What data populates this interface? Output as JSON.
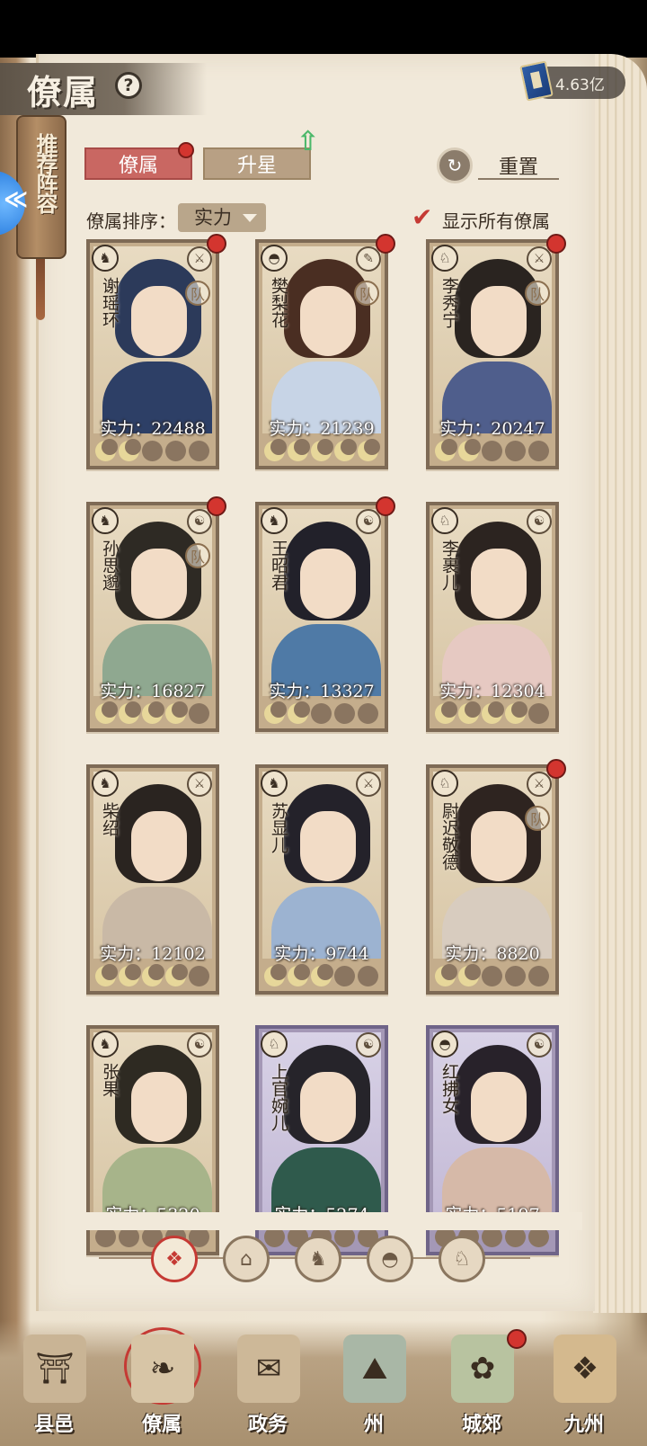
{
  "header": {
    "title": "僚属",
    "currency_value": "4.63亿"
  },
  "recommend": {
    "label": "推荐阵容"
  },
  "tabs": [
    {
      "label": "僚属"
    },
    {
      "label": "升星"
    }
  ],
  "reset_label": "重置",
  "sort": {
    "label": "僚属排序：",
    "value": "实力"
  },
  "show_all": {
    "label": "显示所有僚属",
    "checked": true
  },
  "team_mark": "队",
  "cards": [
    {
      "name": "谢瑶环",
      "power_text": "实力：22488",
      "stars_on": 2,
      "team": true,
      "dot": true,
      "theme": "tan",
      "hair": "#2c3a5a",
      "robe": "#2d3f66"
    },
    {
      "name": "樊梨花",
      "power_text": "实力：21239",
      "stars_on": 5,
      "team": true,
      "dot": true,
      "theme": "tan",
      "hair": "#4a2e22",
      "robe": "#c7d4e6"
    },
    {
      "name": "李秀宁",
      "power_text": "实力：20247",
      "stars_on": 2,
      "team": true,
      "dot": true,
      "theme": "tan",
      "hair": "#2a2420",
      "robe": "#4f5e8c"
    },
    {
      "name": "孙思邈",
      "power_text": "实力：16827",
      "stars_on": 4,
      "team": true,
      "dot": true,
      "theme": "tan",
      "hair": "#2e2a24",
      "robe": "#8fa890"
    },
    {
      "name": "王昭君",
      "power_text": "实力：13327",
      "stars_on": 2,
      "team": false,
      "dot": true,
      "theme": "tan",
      "hair": "#22212a",
      "robe": "#4f7aa6"
    },
    {
      "name": "李裹儿",
      "power_text": "实力：12304",
      "stars_on": 4,
      "team": false,
      "dot": false,
      "theme": "tan",
      "hair": "#2c2420",
      "robe": "#e6c9c2"
    },
    {
      "name": "柴绍",
      "power_text": "实力：12102",
      "stars_on": 4,
      "team": false,
      "dot": false,
      "theme": "tan",
      "hair": "#2a2420",
      "robe": "#c9b9a6"
    },
    {
      "name": "苏显儿",
      "power_text": "实力：9744",
      "stars_on": 3,
      "team": false,
      "dot": false,
      "theme": "tan",
      "hair": "#24222a",
      "robe": "#9cb3d1"
    },
    {
      "name": "尉迟敬德",
      "power_text": "实力：8820",
      "stars_on": 2,
      "team": true,
      "dot": true,
      "theme": "tan",
      "hair": "#2e2420",
      "robe": "#d8ccbf"
    },
    {
      "name": "张果",
      "power_text": "实力：5320",
      "stars_on": 0,
      "team": false,
      "dot": false,
      "theme": "tan",
      "hair": "#2e2a22",
      "robe": "#a7b48a"
    },
    {
      "name": "上官婉儿",
      "power_text": "实力：5274",
      "stars_on": 0,
      "team": false,
      "dot": false,
      "theme": "purple",
      "hair": "#26242a",
      "robe": "#2f5a4c"
    },
    {
      "name": "红拂女",
      "power_text": "实力：5197",
      "stars_on": 0,
      "team": false,
      "dot": false,
      "theme": "purple",
      "hair": "#28222a",
      "robe": "#d6b9a8"
    }
  ],
  "filters": [
    "all-icon",
    "pavilion-icon",
    "monkey-icon",
    "fan-icon",
    "horse-icon"
  ],
  "bottom_nav": [
    {
      "label": "县邑",
      "icon": "county-gate-icon"
    },
    {
      "label": "僚属",
      "icon": "scroll-portraits-icon",
      "active": true
    },
    {
      "label": "政务",
      "icon": "documents-icon"
    },
    {
      "label": "州",
      "icon": "mountain-pavilion-icon"
    },
    {
      "label": "城郊",
      "icon": "countryside-icon",
      "dot": true
    },
    {
      "label": "九州",
      "icon": "map-scroll-icon"
    }
  ]
}
